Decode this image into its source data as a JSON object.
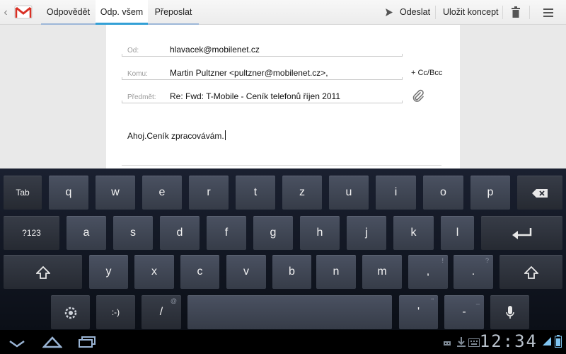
{
  "actionbar": {
    "tabs": [
      "Odpovědět",
      "Odp. všem",
      "Přeposlat"
    ],
    "send_label": "Odeslat",
    "save_draft_label": "Uložit koncept",
    "brand_color": "#d93025",
    "active_color": "#33a0d6"
  },
  "compose": {
    "from_label": "Od:",
    "from_value": "hlavacek@mobilenet.cz",
    "to_label": "Komu:",
    "to_value": "Martin Pultzner <pultzner@mobilenet.cz>,",
    "cc_bcc_label": "+ Cc/Bcc",
    "subject_label": "Předmět:",
    "subject_value": "Re: Fwd: T-Mobile - Ceník telefonů říjen 2011",
    "body_text": "Ahoj.Ceník zpracovávám."
  },
  "keyboard": {
    "row1": [
      "Tab",
      "q",
      "w",
      "e",
      "r",
      "t",
      "z",
      "u",
      "i",
      "o",
      "p",
      "backspace-icon"
    ],
    "row2": [
      "?123",
      "a",
      "s",
      "d",
      "f",
      "g",
      "h",
      "j",
      "k",
      "l",
      "enter-icon"
    ],
    "row3": [
      "shift-icon",
      "y",
      "x",
      "c",
      "v",
      "b",
      "n",
      "m",
      ",",
      ".",
      "shift-icon"
    ],
    "row3_hints": {
      "comma": "!",
      "period": "?"
    },
    "row4": [
      "settings-icon",
      ":-)",
      "/",
      "space",
      "'",
      "-",
      "mic-icon"
    ],
    "row4_hints": {
      "slash": "@",
      "apostrophe": "\"",
      "dash": "_"
    }
  },
  "system": {
    "clock": "12:34"
  }
}
